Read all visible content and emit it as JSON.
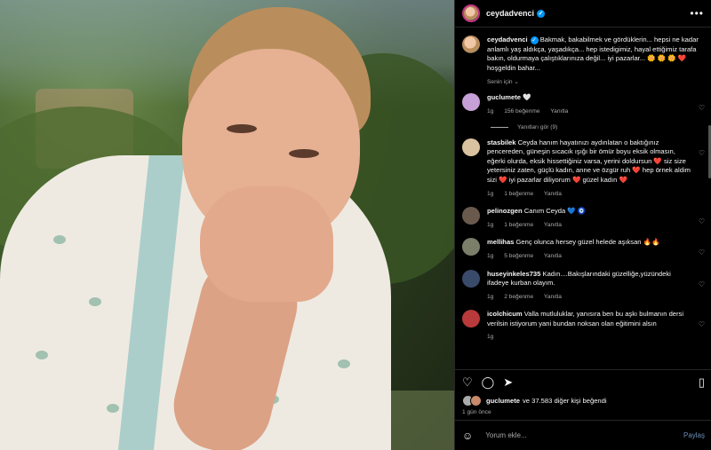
{
  "post": {
    "username": "ceydadvenci",
    "caption_text": "Bakmak, bakabilmek ve gördüklerin... hepsi ne kadar anlamlı yaş aldıkça, yaşadıkça... hep istedigimiz, hayal ettiğimiz tarafa bakın, oldurmaya çalıştıklarınıza değil... iyi pazarlar... 🌼 🌼 🌼 ❤️ hoşgeldin bahar...",
    "translation": "Senin için ⌄",
    "more_icon": "more-horizontal-icon"
  },
  "comments": [
    {
      "user": "guclumete",
      "text": "🤍",
      "time": "1g",
      "likes": "156 beğenme",
      "reply": "Yanıtla",
      "view_replies": "Yanıtları gör (9)",
      "avatar_color": "#c6a0d6"
    },
    {
      "user": "stasbilek",
      "text": "Ceyda hanım hayatınızı aydınlatan o baktığınız pencereden, güneşin sıcacık ışığı bir ömür boyu eksik olmasın, eğerki olurda, eksik hissettiğiniz varsa, yerini doldursun ❤️ siz size yetersiniz zaten, güçlü kadın, anne ve özgür ruh ❤️ hep örnek aldim sizi ❤️ iyi pazarlar diliyorum ❤️ güzel kadın ❤️",
      "time": "1g",
      "likes": "1 beğenme",
      "reply": "Yanıtla",
      "avatar_color": "#d9c2a0"
    },
    {
      "user": "pelinozgen",
      "text": "Canım Ceyda 💙 🧿",
      "time": "1g",
      "likes": "1 beğenme",
      "reply": "Yanıtla",
      "avatar_color": "#6a5a4e"
    },
    {
      "user": "mellihas",
      "text": "Genç olunca hersey güzel helede aşıksan 🔥🔥",
      "time": "1g",
      "likes": "5 beğenme",
      "reply": "Yanıtla",
      "avatar_color": "#7b7f6a"
    },
    {
      "user": "huseyinkeles735",
      "text": "Kadın....Bakışlarındaki güzelliğe,yüzündeki ifadeye kurban olayım.",
      "time": "1g",
      "likes": "2 beğenme",
      "reply": "Yanıtla",
      "avatar_color": "#3a4a6a"
    },
    {
      "user": "icolchicum",
      "text": "Valla mutluluklar, yanısıra ben bu aşkı bulmanın dersi verilsin istiyorum yani bundan noksan olan eğitimini alsın",
      "time": "1g",
      "likes": "",
      "reply": "",
      "avatar_color": "#b83a3a"
    }
  ],
  "footer": {
    "likes_user": "guclumete",
    "likes_text": "ve 37.583 diğer kişi beğendi",
    "time_ago": "1 gün önce",
    "comment_placeholder": "Yorum ekle...",
    "post_label": "Paylaş"
  },
  "icons": {
    "like": "heart-icon",
    "comment": "comment-icon",
    "share": "send-icon",
    "save": "bookmark-icon",
    "emoji": "emoji-icon"
  },
  "colors": {
    "verified": "#0095f6",
    "accent_ring": "#c13584",
    "muted": "#a8a8a8"
  }
}
